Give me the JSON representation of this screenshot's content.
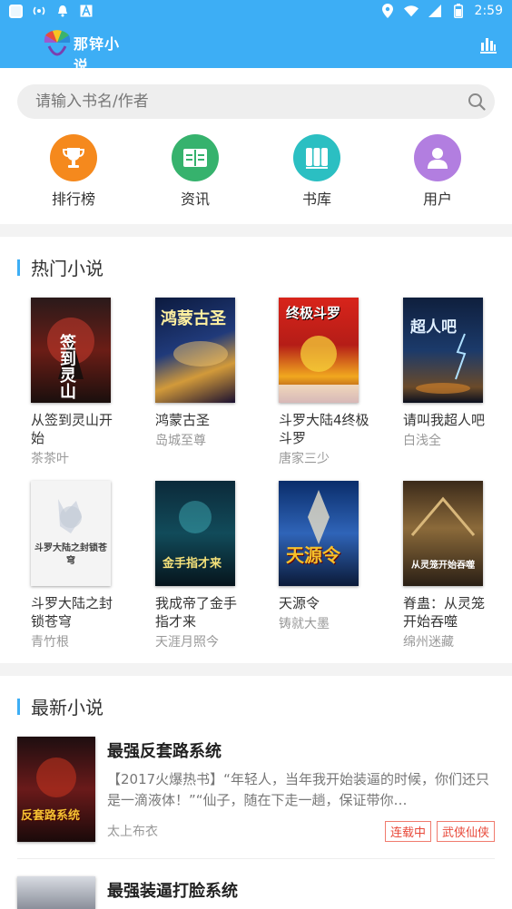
{
  "status_bar": {
    "time": "2:59"
  },
  "app_bar": {
    "logo_text": "那锌小说"
  },
  "search": {
    "placeholder": "请输入书名/作者"
  },
  "quick_nav": [
    {
      "label": "排行榜",
      "color": "#f5891d",
      "icon": "trophy-icon"
    },
    {
      "label": "资讯",
      "color": "#36b26d",
      "icon": "book-open-icon"
    },
    {
      "label": "书库",
      "color": "#2bbfc2",
      "icon": "books-icon"
    },
    {
      "label": "用户",
      "color": "#b27ee0",
      "icon": "user-icon"
    }
  ],
  "hot": {
    "title": "热门小说",
    "books": [
      {
        "title": "从签到灵山开始",
        "author": "茶茶叶",
        "cover_text": "签到灵山"
      },
      {
        "title": "鸿蒙古圣",
        "author": "岛城至尊",
        "cover_text": "鸿蒙古圣"
      },
      {
        "title": "斗罗大陆4终极斗罗",
        "author": "唐家三少",
        "cover_text": "终极斗罗"
      },
      {
        "title": "请叫我超人吧",
        "author": "白浅全",
        "cover_text": "超人吧"
      },
      {
        "title": "斗罗大陆之封锁苍穹",
        "author": "青竹根",
        "cover_text": "斗罗大陆之封锁苍穹"
      },
      {
        "title": "我成帝了金手指才来",
        "author": "天涯月照今",
        "cover_text": "金手指才来"
      },
      {
        "title": "天源令",
        "author": "铸就大墨",
        "cover_text": "天源令"
      },
      {
        "title": "脊蛊：从灵笼开始吞噬",
        "author": "绵州迷藏",
        "cover_text": "从灵笼开始吞噬"
      }
    ]
  },
  "latest": {
    "title": "最新小说",
    "items": [
      {
        "title": "最强反套路系统",
        "desc": "【2017火爆热书】“年轻人，当年我开始装逼的时候，你们还只是一滴液体！”“仙子，随在下走一趟，保证带你…",
        "author": "太上布衣",
        "tags": [
          "连载中",
          "武侠仙侠"
        ],
        "cover_text": "反套路系统"
      },
      {
        "title": "最强装逼打脸系统",
        "desc": "",
        "author": "",
        "tags": [],
        "cover_text": ""
      }
    ]
  },
  "colors": {
    "accent": "#3daef5",
    "tag_red": "#e8493a"
  }
}
